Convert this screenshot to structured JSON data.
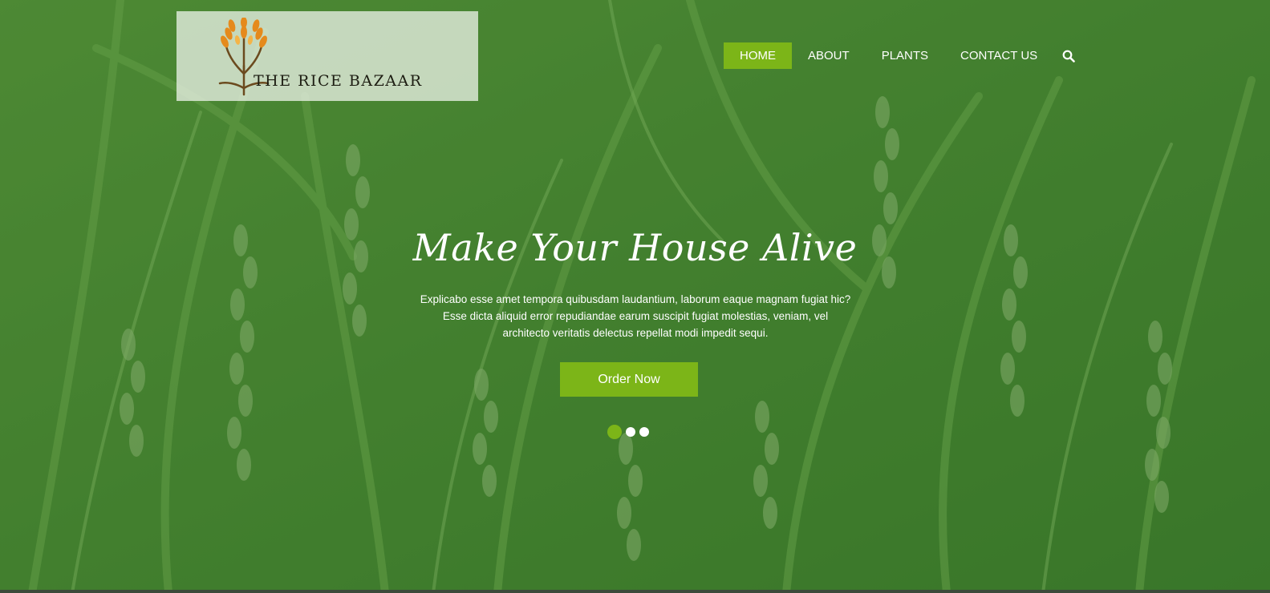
{
  "logo": {
    "text": "THE RICE BAZAAR",
    "icon": "wheat-icon"
  },
  "nav": {
    "items": [
      {
        "label": "HOME",
        "active": true
      },
      {
        "label": "ABOUT",
        "active": false
      },
      {
        "label": "PLANTS",
        "active": false
      },
      {
        "label": "CONTACT US",
        "active": false
      }
    ],
    "search_icon": "search-icon"
  },
  "hero": {
    "headline": "Make Your House Alive",
    "description": "Explicabo esse amet tempora quibusdam laudantium, laborum eaque magnam fugiat hic? Esse dicta aliquid error repudiandae earum suscipit fugiat molestias, veniam, vel architecto veritatis delectus repellat modi impedit sequi.",
    "cta_label": "Order Now"
  },
  "slider": {
    "count": 3,
    "active_index": 0
  },
  "colors": {
    "accent": "#7cb518",
    "overlay": "#3f7a2e",
    "text_light": "#ffffff"
  }
}
